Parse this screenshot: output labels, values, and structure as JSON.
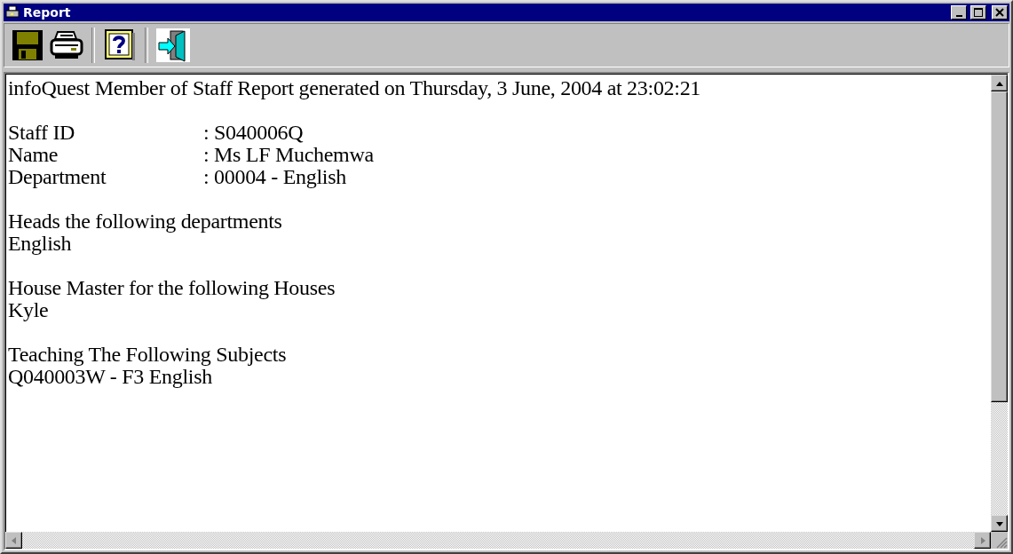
{
  "window": {
    "title": "Report"
  },
  "toolbar": [
    {
      "kind": "save"
    },
    {
      "kind": "print"
    },
    {
      "kind": "separator"
    },
    {
      "kind": "help"
    },
    {
      "kind": "separator"
    },
    {
      "kind": "exit"
    }
  ],
  "report": {
    "heading": "infoQuest Member of Staff Report generated on Thursday, 3 June, 2004 at 23:02:21",
    "fields": [
      {
        "label": "Staff ID",
        "value": ": S040006Q"
      },
      {
        "label": "Name",
        "value": ": Ms LF Muchemwa"
      },
      {
        "label": "Department",
        "value": ": 00004 - English"
      }
    ],
    "sections": [
      {
        "heading": "Heads the following departments",
        "items": [
          "English"
        ]
      },
      {
        "heading": "House Master for the following Houses",
        "items": [
          "Kyle"
        ]
      },
      {
        "heading": "Teaching The Following Subjects",
        "items": [
          "Q040003W - F3 English"
        ]
      }
    ]
  },
  "scrollbars": {
    "horizontal": {
      "disabled": true
    }
  }
}
